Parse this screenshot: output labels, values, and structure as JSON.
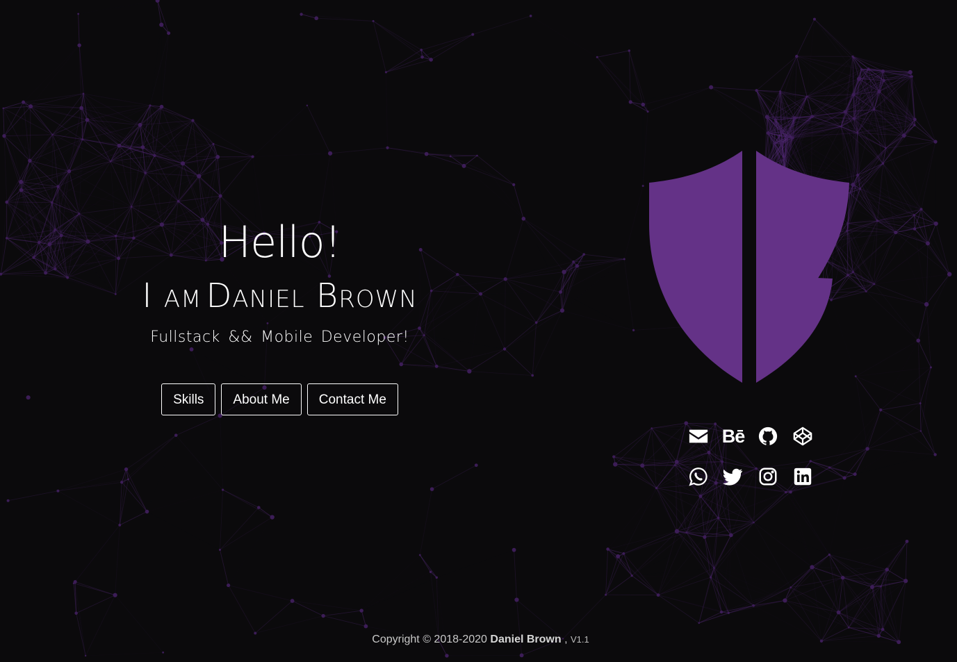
{
  "hero": {
    "greeting": "Hello!",
    "intro_prefix": "I am",
    "name": "Daniel Brown",
    "tagline": "Fullstack && Mobile Developer!"
  },
  "nav_buttons": [
    {
      "label": "Skills"
    },
    {
      "label": "About Me"
    },
    {
      "label": "Contact Me"
    }
  ],
  "logo": {
    "color": "#643287",
    "icon": "shield-logo"
  },
  "social_links": {
    "row1": [
      "envelope-icon",
      "behance-icon",
      "github-icon",
      "codepen-icon"
    ],
    "row2": [
      "whatsapp-icon",
      "twitter-icon",
      "instagram-icon",
      "linkedin-icon"
    ],
    "behance_text": "Bē"
  },
  "footer": {
    "copyright": "Copyright © 2018-2020",
    "name": "Daniel Brown",
    "separator": " ,",
    "version": "V1.1"
  },
  "colors": {
    "background": "#0b0a0c",
    "accent": "#643287",
    "network_lines": "#5a2d82",
    "text": "#ffffff"
  }
}
